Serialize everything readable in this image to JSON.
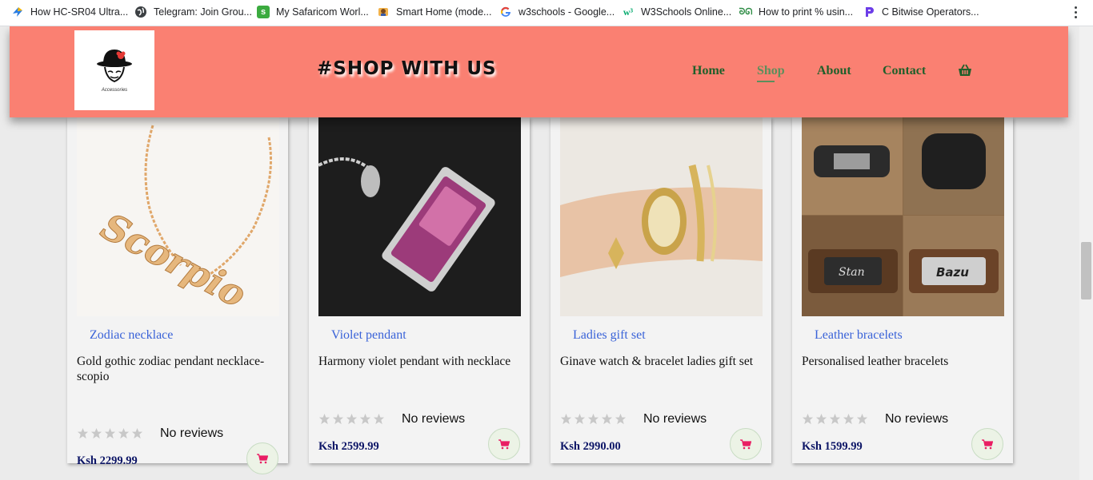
{
  "bookmarks": [
    {
      "label": "How HC-SR04 Ultra...",
      "icon": "lightning-icon"
    },
    {
      "label": "Telegram: Join Grou...",
      "icon": "globe-icon"
    },
    {
      "label": "My Safaricom Worl...",
      "icon": "safaricom-icon"
    },
    {
      "label": "Smart Home (mode...",
      "icon": "person-icon"
    },
    {
      "label": "w3schools - Google...",
      "icon": "google-icon"
    },
    {
      "label": "W3Schools Online...",
      "icon": "w3schools-icon"
    },
    {
      "label": "How to print % usin...",
      "icon": "geeks-icon"
    },
    {
      "label": "C Bitwise Operators...",
      "icon": "programiz-icon"
    }
  ],
  "header": {
    "brand": "#SHOP WITH US",
    "logo_caption": "Accessories",
    "nav": [
      "Home",
      "Shop",
      "About",
      "Contact"
    ],
    "active_nav": "Shop"
  },
  "colors": {
    "header_bg": "#fa8072",
    "nav_text": "#1f5f2a",
    "category_link": "#3a63d8",
    "price": "#0c1566",
    "cart_icon": "#e91e63"
  },
  "products": [
    {
      "category": "Zodiac necklace",
      "title": "Gold gothic zodiac pendant necklace-scopio",
      "rating": 0,
      "reviews": "No reviews",
      "price": "Ksh 2299.99"
    },
    {
      "category": "Violet pendant",
      "title": "Harmony violet pendant with necklace",
      "rating": 0,
      "reviews": "No reviews",
      "price": "Ksh 2599.99"
    },
    {
      "category": "Ladies gift set",
      "title": "Ginave watch & bracelet ladies gift set",
      "rating": 0,
      "reviews": "No reviews",
      "price": "Ksh 2990.00"
    },
    {
      "category": "Leather bracelets",
      "title": "Personalised leather bracelets",
      "rating": 0,
      "reviews": "No reviews",
      "price": "Ksh 1599.99"
    }
  ]
}
